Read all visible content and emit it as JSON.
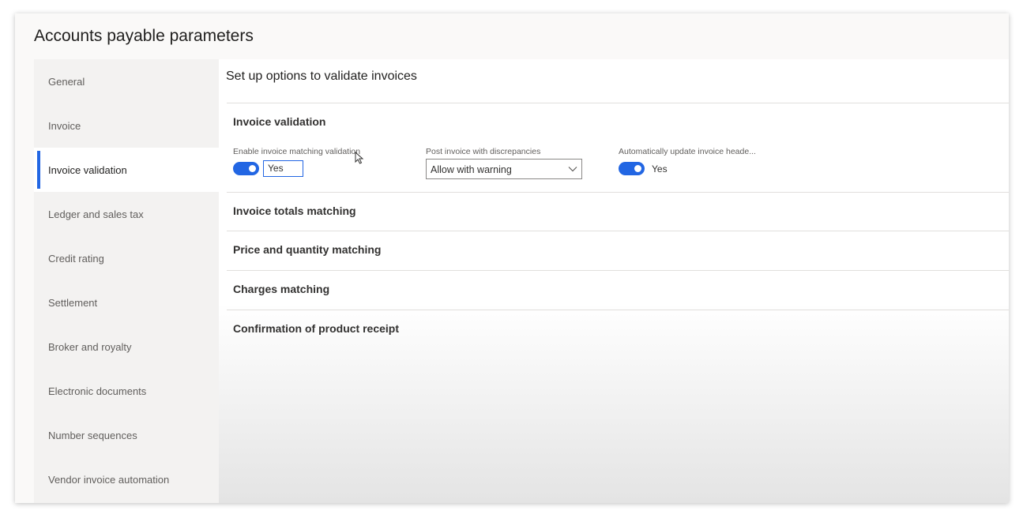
{
  "page": {
    "title": "Accounts payable parameters"
  },
  "nav": {
    "items": [
      {
        "label": "General"
      },
      {
        "label": "Invoice"
      },
      {
        "label": "Invoice validation"
      },
      {
        "label": "Ledger and sales tax"
      },
      {
        "label": "Credit rating"
      },
      {
        "label": "Settlement"
      },
      {
        "label": "Broker and royalty"
      },
      {
        "label": "Electronic documents"
      },
      {
        "label": "Number sequences"
      },
      {
        "label": "Vendor invoice automation"
      }
    ],
    "active_index": 2
  },
  "content": {
    "title": "Set up options to validate invoices",
    "sections": [
      {
        "title": "Invoice validation",
        "expanded": true
      },
      {
        "title": "Invoice totals matching"
      },
      {
        "title": "Price and quantity matching"
      },
      {
        "title": "Charges matching"
      },
      {
        "title": "Confirmation of product receipt"
      }
    ],
    "fields": {
      "enable_matching": {
        "label": "Enable invoice matching validation",
        "value": "Yes",
        "on": true
      },
      "post_with_discrepancies": {
        "label": "Post invoice with discrepancies",
        "value": "Allow with warning"
      },
      "auto_update_header": {
        "label": "Automatically update invoice heade...",
        "value": "Yes",
        "on": true
      }
    }
  },
  "colors": {
    "accent": "#2266e3",
    "nav_background": "#f3f2f1",
    "text": "#323130"
  },
  "icons": [
    "chevron-down-icon",
    "mouse-cursor-icon"
  ]
}
